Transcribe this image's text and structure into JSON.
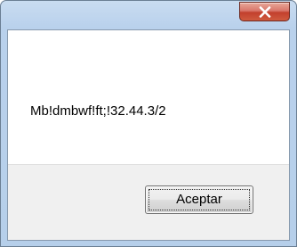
{
  "dialog": {
    "message": "Mb!dmbwf!ft;!32.44.3/2",
    "ok_label": "Aceptar",
    "close_icon": "close-icon"
  },
  "colors": {
    "close_button": "#c2402d",
    "frame": "#b9d1ec",
    "footer": "#f0f0f0"
  }
}
